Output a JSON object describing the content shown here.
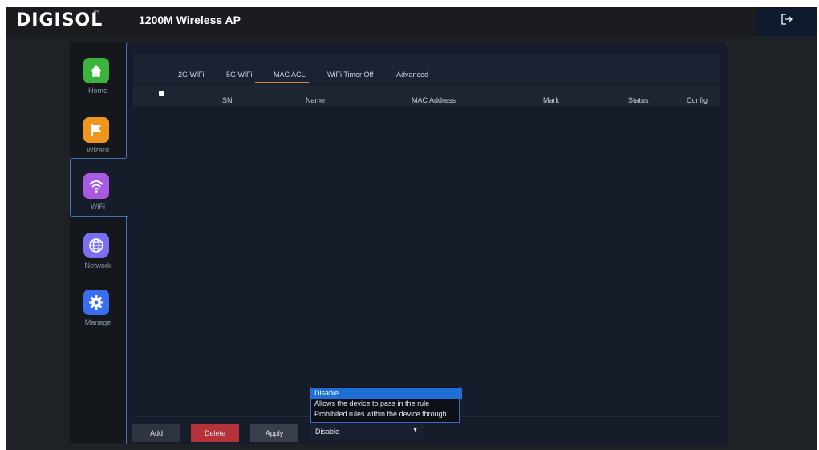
{
  "header": {
    "brand": "DIGISOL",
    "brand_tm": "TM",
    "product": "1200M Wireless AP",
    "logout_icon": "logout-icon"
  },
  "sidebar": {
    "items": [
      {
        "label": "Home",
        "icon": "home-icon",
        "color": "#3cb43c"
      },
      {
        "label": "Wizard",
        "icon": "flag-icon",
        "color": "#f0961e"
      },
      {
        "label": "WiFi",
        "icon": "wifi-icon",
        "color": "#a85ae0"
      },
      {
        "label": "Network",
        "icon": "globe-icon",
        "color": "#7a6ff0"
      },
      {
        "label": "Manage",
        "icon": "gear-icon",
        "color": "#3a6ef0"
      }
    ],
    "active": "WiFi"
  },
  "tabs": [
    "2G WiFi",
    "5G WiFi",
    "MAC ACL",
    "WiFi Timer Off",
    "Advanced"
  ],
  "active_tab": "MAC ACL",
  "table": {
    "headers": {
      "sn": "SN",
      "name": "Name",
      "mac": "MAC Address",
      "mark": "Mark",
      "status": "Status",
      "config": "Config"
    },
    "rows": []
  },
  "buttons": {
    "add": "Add",
    "delete": "Delete",
    "apply": "Apply"
  },
  "mode_select": {
    "value": "Disable",
    "options": [
      "Disable",
      "Allows the device to pass in the rule",
      "Prohibited rules within the device through"
    ]
  },
  "colors": {
    "accent": "#4a6fb8",
    "delete": "#b5323b",
    "highlight": "#1e6fd6",
    "tab_underline": "#c8884e"
  }
}
